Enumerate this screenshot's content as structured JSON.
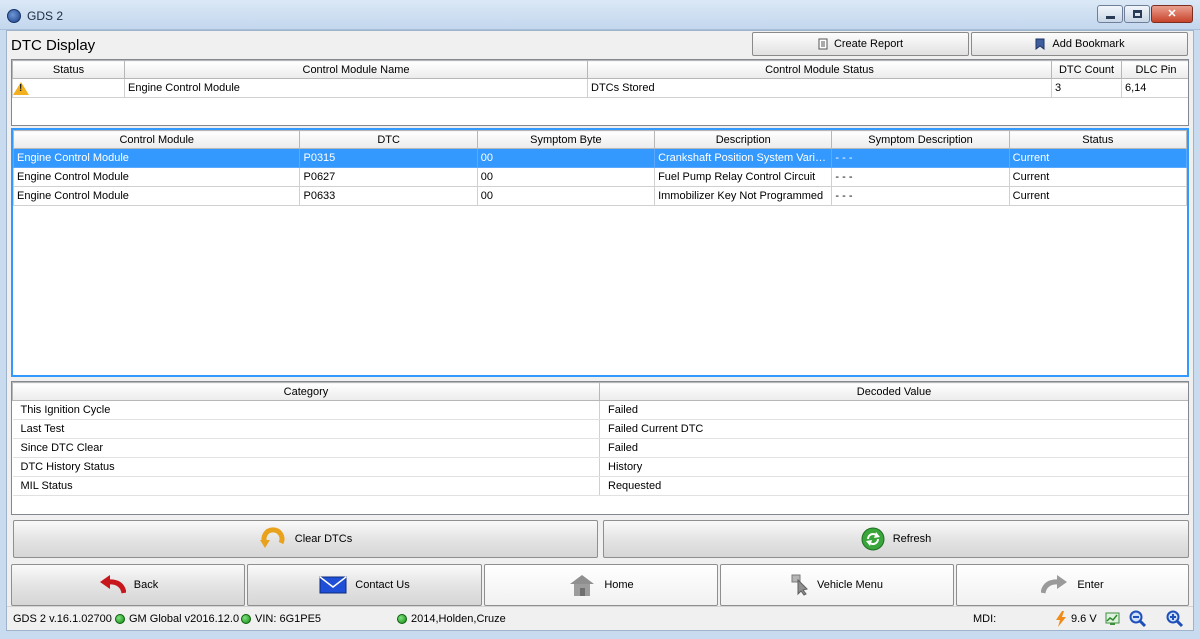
{
  "window": {
    "title": "GDS 2"
  },
  "page": {
    "title": "DTC Display"
  },
  "toolbar": {
    "create_report": "Create Report",
    "add_bookmark": "Add Bookmark"
  },
  "modules": {
    "columns": [
      "Status",
      "Control Module Name",
      "Control Module Status",
      "DTC Count",
      "DLC Pin"
    ],
    "rows": [
      {
        "status_icon": "warning-icon",
        "name": "Engine Control Module",
        "module_status": "DTCs Stored",
        "dtc_count": "3",
        "dlc_pin": "6,14"
      }
    ]
  },
  "dtcs": {
    "columns": [
      "Control Module",
      "DTC",
      "Symptom Byte",
      "Description",
      "Symptom Description",
      "Status"
    ],
    "rows": [
      {
        "module": "Engine Control Module",
        "dtc": "P0315",
        "symptom_byte": "00",
        "description": "Crankshaft Position System Variat...",
        "symptom_description": "- - -",
        "status": "Current"
      },
      {
        "module": "Engine Control Module",
        "dtc": "P0627",
        "symptom_byte": "00",
        "description": "Fuel Pump Relay Control Circuit",
        "symptom_description": "- - -",
        "status": "Current"
      },
      {
        "module": "Engine Control Module",
        "dtc": "P0633",
        "symptom_byte": "00",
        "description": "Immobilizer Key Not Programmed",
        "symptom_description": "- - -",
        "status": "Current"
      }
    ]
  },
  "decoded": {
    "columns": [
      "Category",
      "Decoded Value"
    ],
    "rows": [
      {
        "category": "This Ignition Cycle",
        "value": "Failed"
      },
      {
        "category": "Last Test",
        "value": "Failed Current DTC"
      },
      {
        "category": "Since DTC Clear",
        "value": "Failed"
      },
      {
        "category": "DTC History Status",
        "value": "History"
      },
      {
        "category": "MIL Status",
        "value": "Requested"
      }
    ]
  },
  "actions": {
    "clear_dtcs": "Clear DTCs",
    "refresh": "Refresh"
  },
  "nav": {
    "back": "Back",
    "contact_us": "Contact Us",
    "home": "Home",
    "vehicle_menu": "Vehicle Menu",
    "enter": "Enter"
  },
  "statusbar": {
    "version": "GDS 2 v.16.1.02700",
    "gm_global": "GM Global v2016.12.0",
    "vin": "VIN: 6G1PE5",
    "vehicle": "2014,Holden,Cruze",
    "mdi": "MDI:",
    "voltage": "9.6 V"
  },
  "colors": {
    "selection": "#3399ff",
    "led_green": "#1fa81f",
    "warning": "#f2b01e"
  }
}
